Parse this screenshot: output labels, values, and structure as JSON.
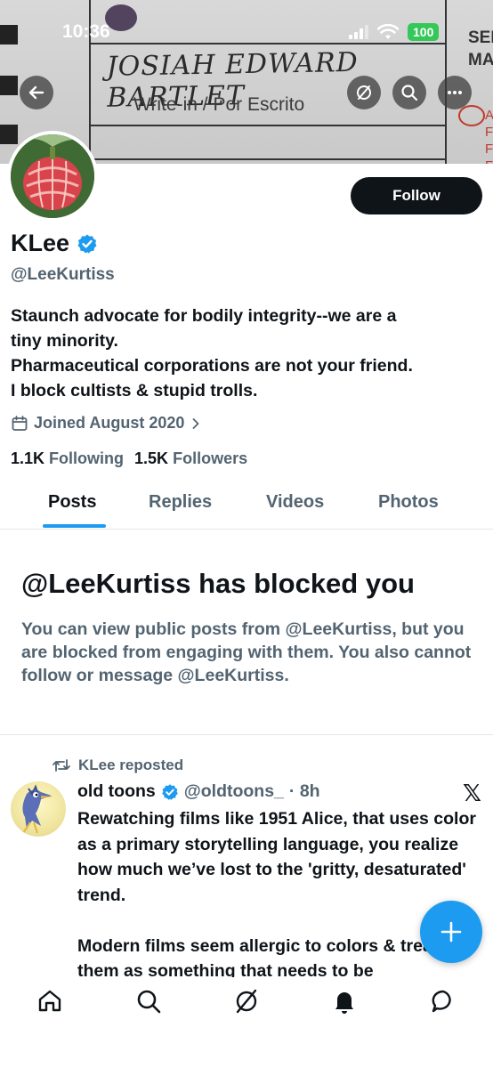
{
  "status_bar": {
    "time": "10:36",
    "battery": "100"
  },
  "banner": {
    "writein_name": "JOSIAH EDWARD BARTLET",
    "writein_label": "Write-in / Por Escrito",
    "edge_text": [
      "SEN",
      "MA"
    ],
    "edge_letters": [
      "A",
      "F",
      "F",
      "F"
    ]
  },
  "header_buttons": {
    "back": "back-arrow-icon",
    "grok": "grok-icon",
    "search": "search-icon",
    "more": "more-icon"
  },
  "profile": {
    "display_name": "KLee",
    "handle": "@LeeKurtiss",
    "follow_label": "Follow",
    "bio_lines": [
      "Staunch advocate for bodily integrity--we are a",
      "tiny minority.",
      "Pharmaceutical corporations are not your friend.",
      "I block cultists & stupid trolls."
    ],
    "joined": "Joined August 2020",
    "following_count": "1.1K",
    "following_label": "Following",
    "followers_count": "1.5K",
    "followers_label": "Followers"
  },
  "tabs": [
    {
      "label": "Posts",
      "active": true
    },
    {
      "label": "Replies",
      "active": false
    },
    {
      "label": "Videos",
      "active": false
    },
    {
      "label": "Photos",
      "active": false
    }
  ],
  "blocked": {
    "title": "@LeeKurtiss has blocked you",
    "message": "You can view public posts from @LeeKurtiss, but you are blocked from engaging with them. You also cannot follow or message @LeeKurtiss."
  },
  "post": {
    "repost_label": "KLee reposted",
    "author_name": "old toons",
    "author_handle": "@oldtoons_",
    "time": "· 8h",
    "source_logo": "𝕏",
    "text": "Rewatching films like 1951 Alice, that uses color as a primary storytelling language, you realize how much we’ve lost to the 'gritty, desaturated' trend.\n\nModern films seem allergic to colors & treat them as something that needs to be"
  },
  "bottom_nav": [
    "home-icon",
    "search-icon",
    "grok-icon",
    "notifications-icon",
    "messages-icon"
  ],
  "colors": {
    "accent": "#1d9bf0",
    "text": "#0f1419",
    "muted": "#536471",
    "battery": "#34c759"
  }
}
